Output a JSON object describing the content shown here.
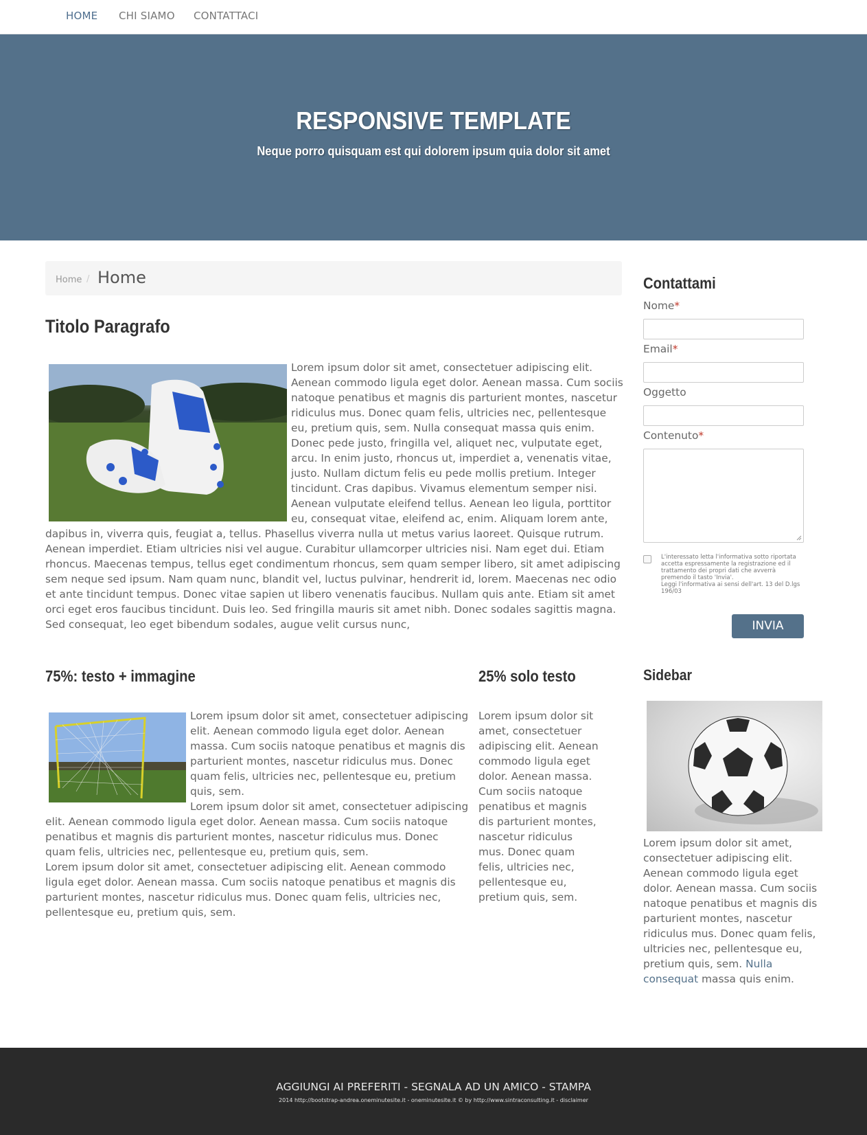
{
  "nav": {
    "items": [
      {
        "label": "HOME",
        "active": true
      },
      {
        "label": "CHI SIAMO",
        "active": false
      },
      {
        "label": "CONTATTACI",
        "active": false
      }
    ]
  },
  "hero": {
    "title": "RESPONSIVE TEMPLATE",
    "subtitle": "Neque porro quisquam est qui dolorem ipsum quia dolor sit amet",
    "background_color": "#54718a"
  },
  "breadcrumb": {
    "home": "Home",
    "separator": "/",
    "current": "Home"
  },
  "main": {
    "title": "Titolo Paragrafo",
    "image_icon": "soccer-shoes-image",
    "paragraph": "Lorem ipsum dolor sit amet, consectetuer adipiscing elit. Aenean commodo ligula eget dolor. Aenean massa. Cum sociis natoque penatibus et magnis dis parturient montes, nascetur ridiculus mus. Donec quam felis, ultricies nec, pellentesque eu, pretium quis, sem. Nulla consequat massa quis enim. Donec pede justo, fringilla vel, aliquet nec, vulputate eget, arcu. In enim justo, rhoncus ut, imperdiet a, venenatis vitae, justo. Nullam dictum felis eu pede mollis pretium. Integer tincidunt. Cras dapibus. Vivamus elementum semper nisi. Aenean vulputate eleifend tellus. Aenean leo ligula, porttitor eu, consequat vitae, eleifend ac, enim. Aliquam lorem ante, dapibus in, viverra quis, feugiat a, tellus. Phasellus viverra nulla ut metus varius laoreet. Quisque rutrum. Aenean imperdiet. Etiam ultricies nisi vel augue. Curabitur ullamcorper ultricies nisi. Nam eget dui. Etiam rhoncus. Maecenas tempus, tellus eget condimentum rhoncus, sem quam semper libero, sit amet adipiscing sem neque sed ipsum. Nam quam nunc, blandit vel, luctus pulvinar, hendrerit id, lorem. Maecenas nec odio et ante tincidunt tempus. Donec vitae sapien ut libero venenatis faucibus. Nullam quis ante. Etiam sit amet orci eget eros faucibus tincidunt. Duis leo. Sed fringilla mauris sit amet nibh. Donec sodales sagittis magna. Sed consequat, leo eget bibendum sodales, augue velit cursus nunc,"
  },
  "col75": {
    "title": "75%: testo + immagine",
    "image_icon": "soccer-goal-image",
    "paragraph1": "Lorem ipsum dolor sit amet, consectetuer adipiscing elit. Aenean commodo ligula eget dolor. Aenean massa. Cum sociis natoque penatibus et magnis dis parturient montes, nascetur ridiculus mus. Donec quam felis, ultricies nec, pellentesque eu, pretium quis, sem.",
    "paragraph2": "Lorem ipsum dolor sit amet, consectetuer adipiscing elit. Aenean commodo ligula eget dolor. Aenean massa. Cum sociis natoque penatibus et magnis dis parturient montes, nascetur ridiculus mus. Donec quam felis, ultricies nec, pellentesque eu, pretium quis, sem.",
    "paragraph3": "Lorem ipsum dolor sit amet, consectetuer adipiscing elit. Aenean commodo ligula eget dolor. Aenean massa. Cum sociis natoque penatibus et magnis dis parturient montes, nascetur ridiculus mus. Donec quam felis, ultricies nec, pellentesque eu, pretium quis, sem."
  },
  "col25": {
    "title": "25% solo testo",
    "paragraph": "Lorem ipsum dolor sit amet, consectetuer adipiscing elit. Aenean commodo ligula eget dolor. Aenean massa. Cum sociis natoque penatibus et magnis dis parturient montes, nascetur ridiculus mus. Donec quam felis, ultricies nec, pellentesque eu, pretium quis, sem."
  },
  "contact": {
    "title": "Contattami",
    "name_label": "Nome",
    "email_label": "Email",
    "subject_label": "Oggetto",
    "content_label": "Contenuto",
    "required_mark": "*",
    "privacy_text": "L'interessato letta l'informativa sotto riportata accetta espressamente la registrazione ed il trattamento dei propri dati che avverrà premendo il tasto 'Invia'.",
    "privacy_link": "Leggi l'informativa ai sensi dell'art. 13 del D.lgs 196/03",
    "submit_label": "INVIA"
  },
  "sidebar": {
    "title": "Sidebar",
    "image_icon": "soccer-ball-image",
    "text": "Lorem ipsum dolor sit amet, consectetuer adipiscing elit. Aenean commodo ligula eget dolor. Aenean massa. Cum sociis natoque penatibus et magnis dis parturient montes, nascetur ridiculus mus. Donec quam felis, ultricies nec, pellentesque eu, pretium quis, sem.",
    "link_text": "Nulla consequat",
    "text_after": "massa quis enim."
  },
  "footer": {
    "links": "AGGIUNGI AI PREFERITI - SEGNALA AD UN AMICO - STAMPA",
    "small": "2014 http://bootstrap-andrea.oneminutesite.it - oneminutesite.it © by http://www.sintraconsulting.it - disclaimer"
  },
  "colors": {
    "accent": "#54718a",
    "footer_bg": "#2a2a2a",
    "required": "#c0392b"
  }
}
